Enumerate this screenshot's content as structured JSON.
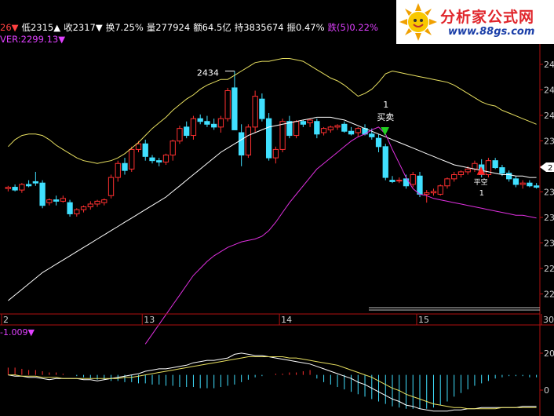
{
  "header": {
    "line1": [
      {
        "text": "26▼",
        "color": "#ff4040"
      },
      {
        "text": "低2315▲",
        "color": "#ffffff"
      },
      {
        "text": "收2317▼",
        "color": "#ffffff"
      },
      {
        "text": "换7.25%",
        "color": "#ffffff"
      },
      {
        "text": "量277924",
        "color": "#ffffff"
      },
      {
        "text": "额64.5亿",
        "color": "#ffffff"
      },
      {
        "text": "持3835674",
        "color": "#ffffff"
      },
      {
        "text": "振0.47%",
        "color": "#ffffff"
      },
      {
        "text": "跌(5)0.22%",
        "color": "#e040ff"
      }
    ],
    "line2": {
      "text": "VER:2299.13▼",
      "color": "#e040ff"
    }
  },
  "logo": {
    "title": "分析家公式网",
    "url": "www.88gs.com"
  },
  "colors": {
    "up": "#ff3030",
    "down": "#40e0ff",
    "upper_band": "#e8e060",
    "lower_line": "#e030e0",
    "mid_line": "#ffffff",
    "grid": "#8a1010",
    "axis": "#b01010"
  },
  "chart_data": [
    {
      "type": "candlestick",
      "title": "",
      "x_ticks": [
        {
          "i": 0,
          "label": "2"
        },
        {
          "i": 20,
          "label": "13"
        },
        {
          "i": 40,
          "label": "14"
        },
        {
          "i": 60,
          "label": "15"
        },
        {
          "i": 77,
          "label": "30"
        }
      ],
      "y_axis_labels": [
        "24",
        "24",
        "24",
        "23",
        "23",
        "23",
        "23",
        "23",
        "22",
        "22"
      ],
      "price_tag": "2",
      "annotations": [
        {
          "i": 33,
          "text": "2434",
          "kind": "high-label"
        },
        {
          "i": 55,
          "text": "1",
          "kind": "signal-top"
        },
        {
          "i": 55,
          "text": "买卖",
          "kind": "signal-text"
        },
        {
          "i": 55,
          "text": "▼",
          "kind": "sell-arrow",
          "color": "#20d020"
        },
        {
          "i": 69,
          "text": "▲",
          "kind": "buy-arrow",
          "color": "#ff2020"
        },
        {
          "i": 69,
          "text": "平空",
          "kind": "signal-text"
        },
        {
          "i": 69,
          "text": "1",
          "kind": "signal-bottom"
        }
      ],
      "ylim": [
        2270,
        2450
      ],
      "candles": [
        [
          2350,
          2352,
          2348,
          2351
        ],
        [
          2351,
          2353,
          2348,
          2349
        ],
        [
          2349,
          2354,
          2347,
          2353
        ],
        [
          2353,
          2356,
          2351,
          2352
        ],
        [
          2355,
          2362,
          2352,
          2354
        ],
        [
          2354,
          2356,
          2336,
          2338
        ],
        [
          2340,
          2343,
          2338,
          2342
        ],
        [
          2342,
          2345,
          2338,
          2341
        ],
        [
          2341,
          2345,
          2340,
          2343
        ],
        [
          2340,
          2342,
          2330,
          2332
        ],
        [
          2332,
          2336,
          2330,
          2335
        ],
        [
          2335,
          2338,
          2333,
          2337
        ],
        [
          2337,
          2341,
          2335,
          2339
        ],
        [
          2339,
          2342,
          2337,
          2341
        ],
        [
          2340,
          2343,
          2338,
          2342
        ],
        [
          2345,
          2360,
          2343,
          2358
        ],
        [
          2358,
          2370,
          2355,
          2368
        ],
        [
          2368,
          2372,
          2360,
          2363
        ],
        [
          2364,
          2380,
          2362,
          2378
        ],
        [
          2378,
          2384,
          2376,
          2382
        ],
        [
          2382,
          2385,
          2370,
          2373
        ],
        [
          2372,
          2374,
          2368,
          2370
        ],
        [
          2370,
          2372,
          2366,
          2369
        ],
        [
          2369,
          2375,
          2367,
          2374
        ],
        [
          2374,
          2385,
          2370,
          2384
        ],
        [
          2384,
          2395,
          2382,
          2393
        ],
        [
          2394,
          2398,
          2386,
          2388
        ],
        [
          2388,
          2402,
          2385,
          2400
        ],
        [
          2400,
          2403,
          2396,
          2398
        ],
        [
          2398,
          2402,
          2394,
          2396
        ],
        [
          2396,
          2400,
          2392,
          2394
        ],
        [
          2394,
          2402,
          2390,
          2400
        ],
        [
          2400,
          2422,
          2398,
          2420
        ],
        [
          2422,
          2434,
          2412,
          2392
        ],
        [
          2390,
          2396,
          2366,
          2374
        ],
        [
          2374,
          2396,
          2372,
          2394
        ],
        [
          2394,
          2420,
          2390,
          2416
        ],
        [
          2414,
          2418,
          2398,
          2400
        ],
        [
          2400,
          2404,
          2370,
          2372
        ],
        [
          2372,
          2380,
          2368,
          2378
        ],
        [
          2378,
          2400,
          2376,
          2398
        ],
        [
          2398,
          2402,
          2386,
          2388
        ],
        [
          2388,
          2399,
          2386,
          2398
        ],
        [
          2398,
          2399,
          2394,
          2396
        ],
        [
          2397,
          2400,
          2394,
          2399
        ],
        [
          2398,
          2400,
          2386,
          2389
        ],
        [
          2390,
          2394,
          2388,
          2393
        ],
        [
          2392,
          2395,
          2390,
          2394
        ],
        [
          2394,
          2396,
          2392,
          2395
        ],
        [
          2396,
          2398,
          2390,
          2391
        ],
        [
          2391,
          2394,
          2388,
          2389
        ],
        [
          2390,
          2394,
          2387,
          2393
        ],
        [
          2393,
          2396,
          2388,
          2389
        ],
        [
          2389,
          2393,
          2385,
          2387
        ],
        [
          2386,
          2389,
          2376,
          2380
        ],
        [
          2380,
          2382,
          2356,
          2358
        ],
        [
          2356,
          2359,
          2354,
          2355
        ],
        [
          2356,
          2358,
          2354,
          2356
        ],
        [
          2357,
          2360,
          2350,
          2352
        ],
        [
          2353,
          2362,
          2351,
          2360
        ],
        [
          2359,
          2362,
          2344,
          2346
        ],
        [
          2346,
          2349,
          2340,
          2347
        ],
        [
          2347,
          2350,
          2345,
          2348
        ],
        [
          2346,
          2353,
          2345,
          2352
        ],
        [
          2352,
          2358,
          2350,
          2357
        ],
        [
          2357,
          2362,
          2355,
          2360
        ],
        [
          2360,
          2363,
          2358,
          2362
        ],
        [
          2362,
          2366,
          2360,
          2364
        ],
        [
          2364,
          2370,
          2362,
          2368
        ],
        [
          2367,
          2371,
          2358,
          2360
        ],
        [
          2360,
          2372,
          2358,
          2370
        ],
        [
          2370,
          2372,
          2364,
          2365
        ],
        [
          2365,
          2367,
          2359,
          2361
        ],
        [
          2361,
          2363,
          2355,
          2357
        ],
        [
          2357,
          2359,
          2351,
          2353
        ],
        [
          2353,
          2356,
          2350,
          2354
        ],
        [
          2354,
          2356,
          2351,
          2352
        ],
        [
          2352,
          2354,
          2350,
          2351
        ]
      ],
      "series": [
        {
          "name": "",
          "role": "upper_band",
          "values": [
            2380,
            2385,
            2388,
            2389,
            2389,
            2388,
            2385,
            2381,
            2378,
            2375,
            2372,
            2370,
            2369,
            2368,
            2369,
            2370,
            2372,
            2375,
            2379,
            2383,
            2388,
            2393,
            2397,
            2401,
            2406,
            2410,
            2414,
            2417,
            2421,
            2424,
            2426,
            2428,
            2428,
            2431,
            2434,
            2437,
            2440,
            2441,
            2441,
            2442,
            2443,
            2443,
            2442,
            2441,
            2438,
            2435,
            2432,
            2429,
            2427,
            2424,
            2420,
            2416,
            2418,
            2421,
            2426,
            2432,
            2434,
            2433,
            2432,
            2431,
            2430,
            2429,
            2428,
            2427,
            2426,
            2424,
            2421,
            2418,
            2415,
            2412,
            2410,
            2409,
            2406,
            2404,
            2402,
            2400,
            2398,
            2396
          ]
        },
        {
          "name": "",
          "role": "middle",
          "values": [
            2270,
            2274,
            2278,
            2282,
            2286,
            2290,
            2293,
            2296,
            2299,
            2302,
            2305,
            2308,
            2311,
            2314,
            2317,
            2320,
            2323,
            2326,
            2329,
            2332,
            2335,
            2338,
            2341,
            2344,
            2348,
            2352,
            2356,
            2360,
            2364,
            2368,
            2372,
            2376,
            2379,
            2382,
            2385,
            2388,
            2390,
            2392,
            2394,
            2395,
            2396,
            2397,
            2398,
            2399,
            2400,
            2401,
            2401,
            2401,
            2400,
            2399,
            2397,
            2395,
            2393,
            2391,
            2389,
            2387,
            2385,
            2383,
            2381,
            2379,
            2377,
            2375,
            2373,
            2371,
            2369,
            2367,
            2366,
            2365,
            2364,
            2363,
            2362,
            2361,
            2360,
            2360,
            2359,
            2359,
            2358,
            2358
          ]
        },
        {
          "name": "",
          "role": "lower_line",
          "values": [
            null,
            null,
            null,
            null,
            null,
            null,
            null,
            null,
            null,
            null,
            null,
            null,
            null,
            null,
            null,
            null,
            null,
            null,
            null,
            null,
            2239,
            2246,
            2253,
            2260,
            2267,
            2274,
            2281,
            2288,
            2293,
            2298,
            2302,
            2305,
            2308,
            2310,
            2312,
            2313,
            2314,
            2316,
            2320,
            2326,
            2333,
            2340,
            2346,
            2352,
            2358,
            2364,
            2368,
            2372,
            2376,
            2380,
            2384,
            2387,
            2389,
            2392,
            2394,
            2389,
            2378,
            2368,
            2358,
            2350,
            2346,
            2345,
            2343,
            2342,
            2341,
            2340,
            2339,
            2338,
            2337,
            2336,
            2335,
            2334,
            2333,
            2332,
            2331,
            2331,
            2330,
            2329
          ]
        }
      ]
    },
    {
      "type": "bar",
      "title": "",
      "label": {
        "text": "-1.009▼",
        "color": "#e040ff"
      },
      "y_axis_labels": [
        "20",
        "0"
      ],
      "ylim": [
        -34,
        40
      ],
      "series": [
        {
          "name": "",
          "role": "dif",
          "values": [
            0,
            -1,
            -1,
            -2,
            -2,
            -3,
            -4,
            -3,
            -3,
            -3,
            -3,
            -4,
            -4,
            -5,
            -4,
            -3,
            -2,
            -1,
            0,
            1,
            3,
            4,
            5,
            5,
            6,
            7,
            8,
            10,
            11,
            12,
            12,
            13,
            14,
            17,
            18,
            17,
            16,
            16,
            15,
            14,
            13,
            12,
            11,
            10,
            9,
            7,
            5,
            3,
            1,
            -1,
            -3,
            -6,
            -8,
            -11,
            -14,
            -17,
            -20,
            -22,
            -25,
            -26,
            -28,
            -29,
            -30,
            -30,
            -30,
            -29,
            -29,
            -28,
            -28,
            -27,
            -27,
            -27,
            -27,
            -27,
            -27,
            -26,
            -26,
            -26
          ]
        },
        {
          "name": "",
          "role": "dea",
          "values": [
            0,
            0,
            -1,
            -1,
            -1,
            -2,
            -2,
            -2,
            -3,
            -3,
            -3,
            -3,
            -3,
            -3,
            -3,
            -3,
            -3,
            -2,
            -2,
            -1,
            0,
            1,
            2,
            3,
            4,
            5,
            6,
            7,
            8,
            9,
            10,
            11,
            12,
            13,
            14,
            15,
            15,
            15,
            15,
            15,
            15,
            14,
            14,
            13,
            12,
            11,
            10,
            9,
            8,
            6,
            4,
            2,
            0,
            -2,
            -5,
            -8,
            -11,
            -13,
            -16,
            -18,
            -20,
            -22,
            -24,
            -25,
            -26,
            -27,
            -27,
            -28,
            -28,
            -28,
            -28,
            -28,
            -27,
            -27,
            -27,
            -27,
            -27,
            -27
          ]
        },
        {
          "name": "",
          "role": "hist",
          "values": [
            6,
            6,
            5,
            4,
            4,
            3,
            2,
            2,
            1,
            0,
            -1,
            -2,
            -3,
            -4,
            -4,
            -5,
            -5,
            -6,
            -6,
            -7,
            -7,
            -8,
            -8,
            -9,
            -9,
            -10,
            -10,
            -10,
            -11,
            -11,
            -11,
            -10,
            -9,
            -8,
            -6,
            -4,
            -2,
            -1,
            0,
            1,
            1,
            2,
            2,
            3,
            4,
            -3,
            -6,
            -8,
            -10,
            -12,
            -14,
            -16,
            -18,
            -20,
            -22,
            -24,
            -26,
            -27,
            -28,
            -28,
            -28,
            -28,
            -27,
            -25,
            -22,
            -18,
            -15,
            -12,
            -9,
            -7,
            -5,
            -3,
            -2,
            -1,
            -1,
            -1,
            -2,
            -2
          ]
        }
      ]
    }
  ]
}
